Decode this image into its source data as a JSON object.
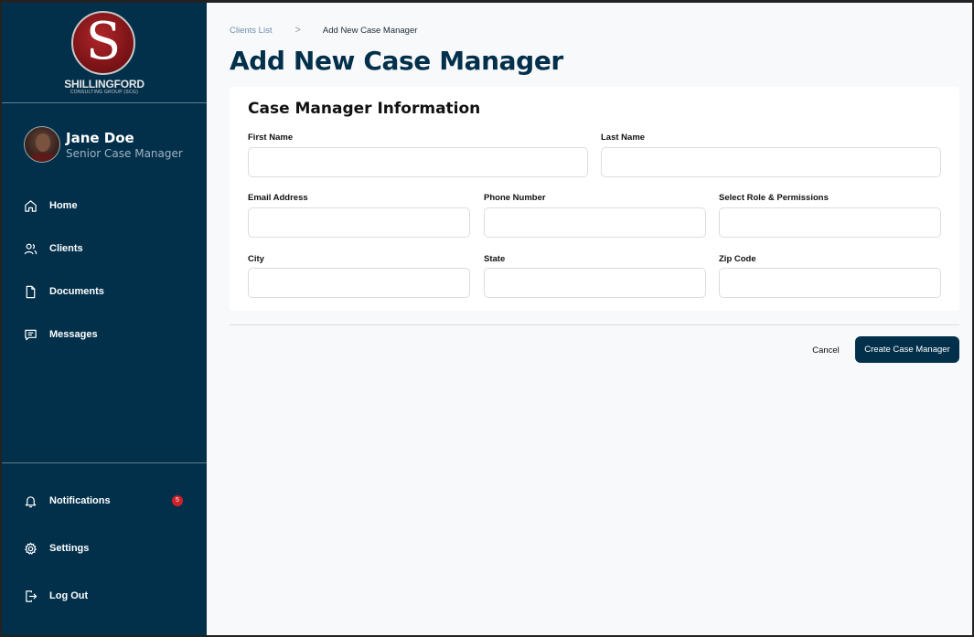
{
  "brand": {
    "logo_letter": "S",
    "name": "SHILLINGFORD",
    "subtitle": "CONSULTING GROUP (SCG)"
  },
  "user": {
    "name": "Jane Doe",
    "role": "Senior Case Manager"
  },
  "nav": {
    "home": "Home",
    "clients": "Clients",
    "documents": "Documents",
    "messages": "Messages"
  },
  "bottom_nav": {
    "notifications": "Notifications",
    "notifications_count": "5",
    "settings": "Settings",
    "logout": "Log Out"
  },
  "breadcrumb": {
    "parent": "Clients List",
    "separator": ">",
    "current": "Add New Case Manager"
  },
  "page": {
    "title": "Add New Case Manager"
  },
  "form": {
    "section_title": "Case Manager Information",
    "first_name": {
      "label": "First Name",
      "value": ""
    },
    "last_name": {
      "label": "Last Name",
      "value": ""
    },
    "email": {
      "label": "Email Address",
      "value": ""
    },
    "phone": {
      "label": "Phone Number",
      "value": ""
    },
    "role": {
      "label": "Select Role & Permissions",
      "value": ""
    },
    "city": {
      "label": "City",
      "value": ""
    },
    "state": {
      "label": "State",
      "value": ""
    },
    "zip": {
      "label": "Zip Code",
      "value": ""
    }
  },
  "actions": {
    "cancel": "Cancel",
    "create": "Create Case Manager"
  },
  "colors": {
    "sidebar_bg": "#02304b",
    "primary": "#02304b",
    "badge": "#d0202a",
    "logo_red": "#7d1418",
    "page_bg": "#f7f9fb"
  }
}
